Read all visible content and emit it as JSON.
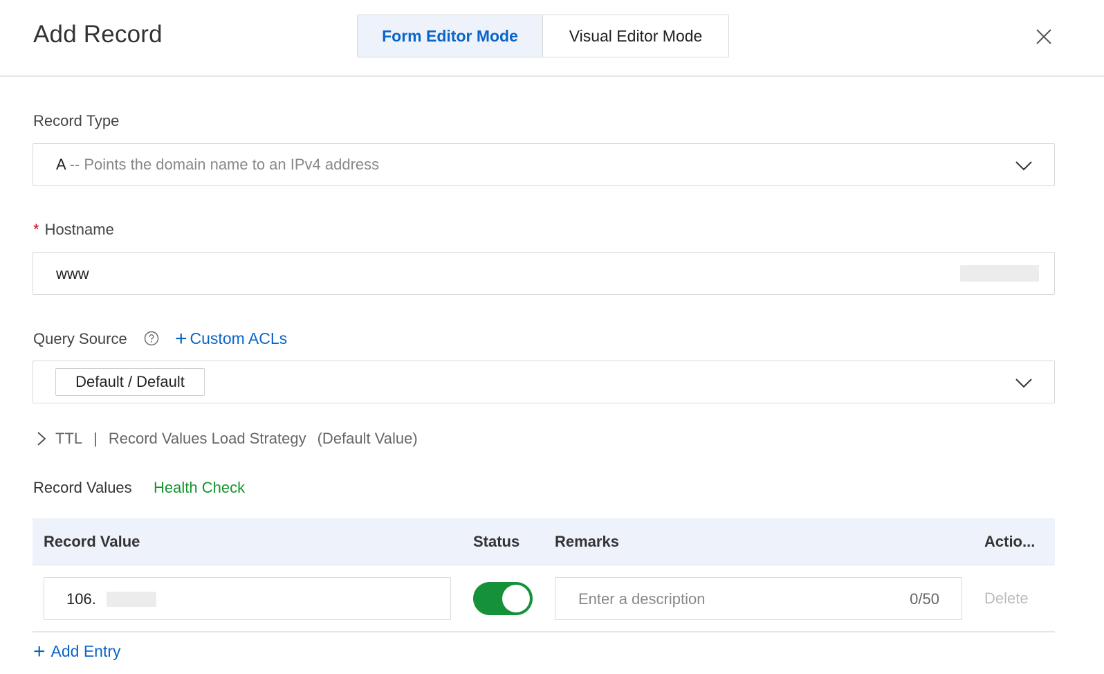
{
  "dialog": {
    "title": "Add Record",
    "modes": {
      "form": "Form Editor Mode",
      "visual": "Visual Editor Mode",
      "active": "form"
    }
  },
  "record_type": {
    "label": "Record Type",
    "value_code": "A",
    "value_desc": "-- Points the domain name to an IPv4 address"
  },
  "hostname": {
    "label": "Hostname",
    "required_mark": "*",
    "value": "www"
  },
  "query_source": {
    "label": "Query Source",
    "custom_acl_label": "Custom ACLs",
    "selected_tag": "Default / Default"
  },
  "ttl_row": {
    "ttl": "TTL",
    "separator": "|",
    "strategy": "Record Values Load Strategy",
    "default_note": "(Default Value)"
  },
  "record_values": {
    "label": "Record Values",
    "health_check": "Health Check",
    "columns": {
      "value": "Record Value",
      "status": "Status",
      "remarks": "Remarks",
      "actions": "Actio..."
    },
    "rows": [
      {
        "value": "106.",
        "status_on": true,
        "remarks_placeholder": "Enter a description",
        "remarks_count": "0/50",
        "action": "Delete"
      }
    ],
    "add_entry": "Add Entry"
  },
  "colors": {
    "accent_blue": "#0a64c8",
    "health_green": "#15952e",
    "toggle_green": "#15913a",
    "required_red": "#d0021b"
  }
}
